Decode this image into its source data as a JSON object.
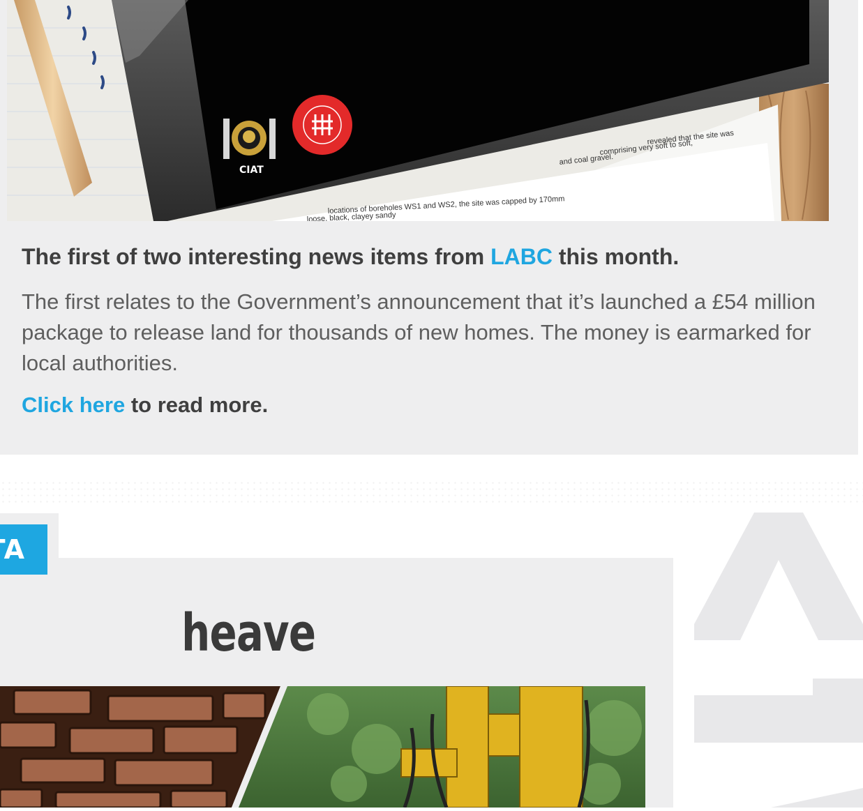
{
  "news": {
    "headline_pre": "The first of two interesting news items from ",
    "headline_link": "LABC",
    "headline_post": " this month.",
    "body": "The first relates to the Government’s announcement that it’s launched a £54 million package to release land for thousands of new homes. The money is earmarked for local authorities.",
    "more_link": "Click here",
    "more_post": " to read more."
  },
  "hero": {
    "ciat_label": "CIAT",
    "doc_line_1": "revealed that the site was",
    "doc_line_2": "comprising very soft to soft,",
    "doc_line_3": "and coal gravel.",
    "doc_line_4": "locations of boreholes WS1 and WS2, the site was capped by 170mm",
    "doc_line_5": "loose, black, clayey sandy"
  },
  "section": {
    "badge": "TA",
    "title": "heave"
  },
  "colors": {
    "accent": "#1fa6e0",
    "card_bg": "#eeeeef",
    "heading": "#3f3f3f",
    "body_text": "#5e5e5e"
  }
}
